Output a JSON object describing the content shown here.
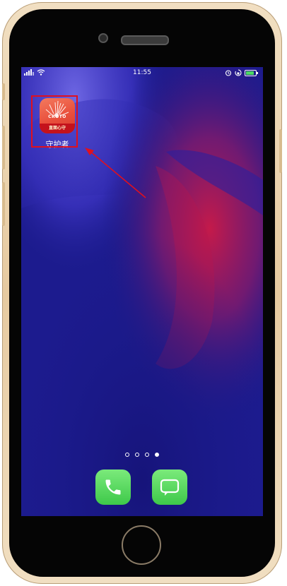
{
  "status_bar": {
    "time": "11:55",
    "left_icons": [
      "signal-icon",
      "wifi-icon"
    ],
    "right_icons": [
      "alarm-icon",
      "rotation-lock-icon",
      "battery-icon"
    ]
  },
  "app": {
    "name": "守护者",
    "icon_text": "CROTO",
    "icon_banner": "直面心守",
    "accent_color": "#e94f3c"
  },
  "annotation": {
    "highlight_color": "#e0101e"
  },
  "page_dots": {
    "count": 4,
    "active_index": 3
  },
  "dock": [
    {
      "name": "phone",
      "icon": "phone-icon",
      "color": "#4cd964"
    },
    {
      "name": "messages",
      "icon": "message-icon",
      "color": "#4cd964"
    }
  ]
}
